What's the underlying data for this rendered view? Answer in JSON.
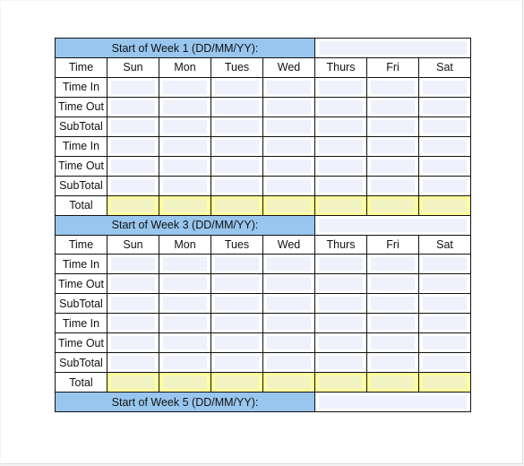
{
  "days": [
    "Sun",
    "Mon",
    "Tues",
    "Wed",
    "Thurs",
    "Fri",
    "Sat"
  ],
  "time_header": "Time",
  "row_labels": [
    "Time In",
    "Time Out",
    "SubTotal",
    "Time In",
    "Time Out",
    "SubTotal"
  ],
  "total_label": "Total",
  "weeks": [
    {
      "title": "Start of Week 1 (DD/MM/YY):",
      "full": true
    },
    {
      "title": "Start of Week 3 (DD/MM/YY):",
      "full": true
    },
    {
      "title": "Start of Week 5 (DD/MM/YY):",
      "full": false
    }
  ],
  "colors": {
    "header": "#99c6ee",
    "total": "#fefe9c",
    "field": "#eff2fd"
  }
}
